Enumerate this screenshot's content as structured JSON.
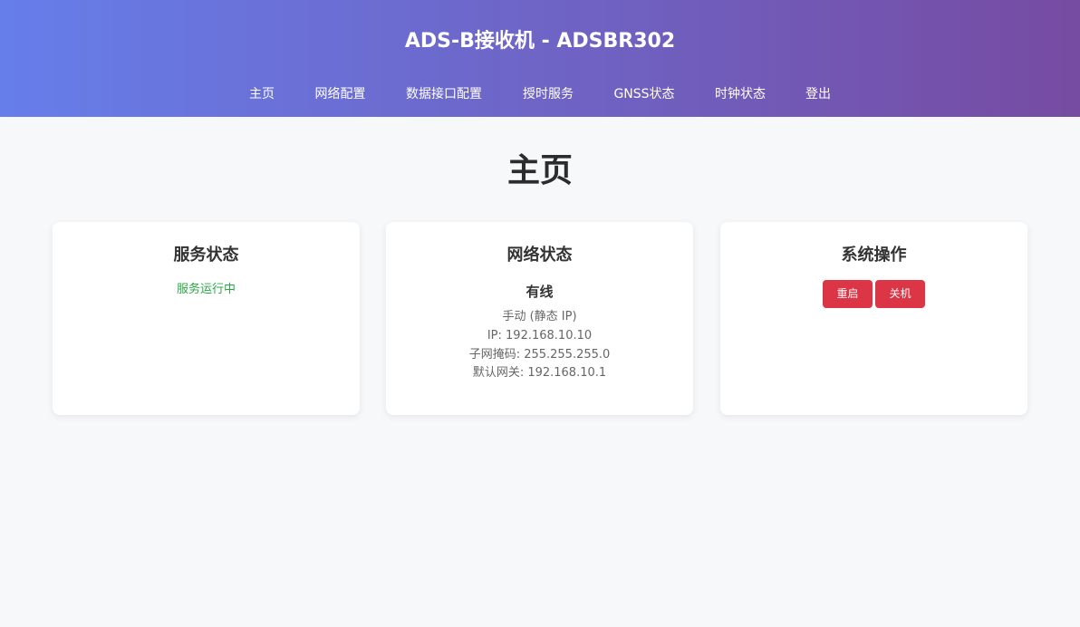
{
  "header": {
    "title": "ADS-B接收机 - ADSBR302"
  },
  "nav": {
    "items": [
      {
        "label": "主页"
      },
      {
        "label": "网络配置"
      },
      {
        "label": "数据接口配置"
      },
      {
        "label": "授时服务"
      },
      {
        "label": "GNSS状态"
      },
      {
        "label": "时钟状态"
      },
      {
        "label": "登出"
      }
    ]
  },
  "main": {
    "page_title": "主页",
    "service_card": {
      "title": "服务状态",
      "status": "服务运行中"
    },
    "network_card": {
      "title": "网络状态",
      "type": "有线",
      "mode": "手动 (静态 IP)",
      "ip": "IP: 192.168.10.10",
      "subnet": "子网掩码: 255.255.255.0",
      "gateway": "默认网关: 192.168.10.1"
    },
    "system_card": {
      "title": "系统操作",
      "restart_label": "重启",
      "shutdown_label": "关机"
    }
  },
  "colors": {
    "header_gradient_start": "#667eea",
    "header_gradient_end": "#764ba2",
    "status_ok": "#28a745",
    "danger": "#dc3545",
    "background": "#f7f8fa"
  }
}
